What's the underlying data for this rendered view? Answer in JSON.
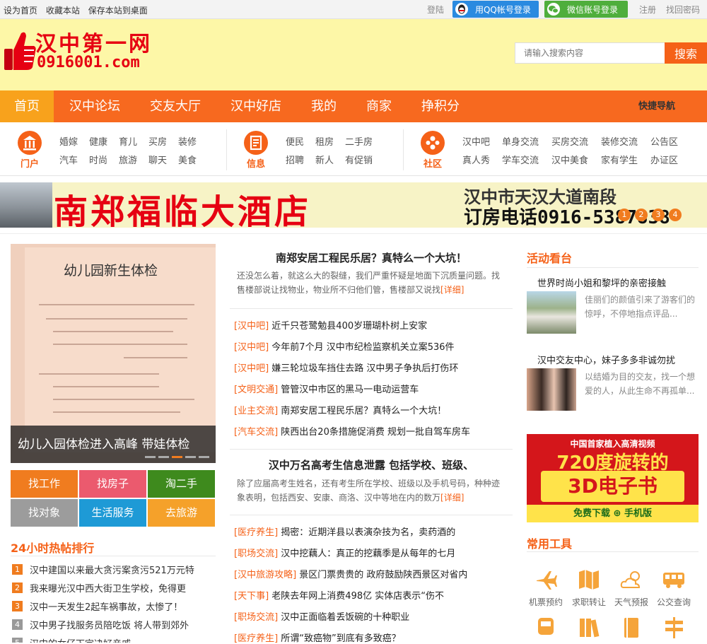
{
  "topbar": {
    "left": [
      "设为首页",
      "收藏本站",
      "保存本站到桌面"
    ],
    "login": "登陆",
    "qq_login": "用QQ帐号登录",
    "wx_login": "微信账号登录",
    "register": "注册",
    "find_password": "找回密码"
  },
  "header": {
    "logo_title": "汉中第一网",
    "logo_url": "0916001.com",
    "search_placeholder": "请输入搜索内容",
    "search_button": "搜索"
  },
  "nav": {
    "items": [
      "首页",
      "汉中论坛",
      "交友大厅",
      "汉中好店",
      "我的",
      "商家",
      "挣积分"
    ],
    "quick": "快捷导航"
  },
  "categories": [
    {
      "name": "门户",
      "icon": "building-icon",
      "links": [
        "婚嫁",
        "健康",
        "育儿",
        "买房",
        "装修",
        "汽车",
        "时尚",
        "旅游",
        "聊天",
        "美食"
      ]
    },
    {
      "name": "信息",
      "icon": "document-icon",
      "links": [
        "便民",
        "租房",
        "二手房",
        "招聘",
        "新人",
        "有促销"
      ]
    },
    {
      "name": "社区",
      "icon": "community-icon",
      "links": [
        "汉中吧",
        "单身交流",
        "买房交流",
        "装修交流",
        "公告区",
        "真人秀",
        "学车交流",
        "汉中美食",
        "家有学生",
        "办证区"
      ]
    }
  ],
  "banner": {
    "title": "南郑福临大酒店",
    "address": "汉中市天汉大道南段",
    "phone": "订房电话0916-5387838",
    "dots": [
      "1",
      "2",
      "3",
      "4"
    ]
  },
  "slider": {
    "paper_title": "幼儿园新生体检",
    "caption": "幼儿入园体检进入高峰 带娃体检"
  },
  "quicklinks": [
    "找工作",
    "找房子",
    "淘二手",
    "找对象",
    "生活服务",
    "去旅游"
  ],
  "hot": {
    "title": "24小时热帖排行",
    "items": [
      "汉中建国以来最大贪污案贪污521万元特",
      "我来曝光汉中西大街卫生学校，免得更",
      "汉中一天发生2起车祸事故，太惨了！",
      "汉中男子找服务员陪吃饭 将人带到郊外",
      "汉中的女仔下定决好亲戚"
    ]
  },
  "middle": {
    "headline1": "南郑安居工程民乐居？真特么一个大坑！",
    "summary1": "还没怎么着，就这么大的裂缝，我们严重怀疑是地面下沉质量问题。找售楼部说让找物业，物业所不归他们管，售楼部又说找",
    "more": "[详细]",
    "news1": [
      {
        "tag": "[汉中吧]",
        "text": "近千只苍鹭勉县400岁珊瑚朴树上安家"
      },
      {
        "tag": "[汉中吧]",
        "text": "今年前7个月 汉中市纪检监察机关立案536件"
      },
      {
        "tag": "[汉中吧]",
        "text": "嫌三轮垃圾车挡住去路 汉中男子争执后打伤环"
      },
      {
        "tag": "[文明交通]",
        "text": "管管汉中市区的黑马一电动运营车"
      },
      {
        "tag": "[业主交流]",
        "text": "南郑安居工程民乐居？真特么一个大坑！"
      },
      {
        "tag": "[汽车交流]",
        "text": "陕西出台20条措施促消费 规划一批自驾车房车"
      }
    ],
    "headline2": "汉中万名高考生信息泄露 包括学校、班级、",
    "summary2": "除了应届高考生姓名，还有考生所在学校、班级以及手机号码，种种迹象表明，包括西安、安康、商洛、汉中等地在内的数万",
    "news2": [
      {
        "tag": "[医疗养生]",
        "text": "揭密：近期洋县以表演杂技为名，卖药酒的"
      },
      {
        "tag": "[职场交流]",
        "text": "汉中挖藕人：真正的挖藕季是从每年的七月"
      },
      {
        "tag": "[汉中旅游攻略]",
        "text": "景区门票贵贵的 政府鼓励陕西景区对省内"
      },
      {
        "tag": "[天下事]",
        "text": "老陕去年网上消费498亿 实体店表示“伤不"
      },
      {
        "tag": "[职场交流]",
        "text": "汉中正面临着丢饭碗的十种职业"
      },
      {
        "tag": "[医疗养生]",
        "text": "所谓“致癌物”到底有多致癌？"
      }
    ]
  },
  "right": {
    "activity_title": "活动看台",
    "activities": [
      {
        "title": "世界时尚小姐和黎坪的亲密接触",
        "desc": "佳丽们的颜值引来了游客们的惊呼，不停地指点评品..."
      },
      {
        "title": "汉中交友中心，妹子多多非诚勿扰",
        "desc": "以结婚为目的交友，找一个想爱的人，从此生命不再孤单..."
      }
    ],
    "ad": {
      "line1": "中国首家植入高清视频",
      "line2": "720度旋转的",
      "line3": "3D电子书",
      "line4": "免费下载 ⊕ 手机版"
    },
    "tools_title": "常用工具",
    "tools": [
      {
        "label": "机票预约",
        "icon": "plane-icon"
      },
      {
        "label": "求职转让",
        "icon": "map-icon"
      },
      {
        "label": "天气预报",
        "icon": "weather-icon"
      },
      {
        "label": "公交查询",
        "icon": "bus-icon"
      },
      {
        "label": "",
        "icon": "train-icon"
      },
      {
        "label": "",
        "icon": "books-icon"
      },
      {
        "label": "",
        "icon": "book-icon"
      },
      {
        "label": "",
        "icon": "signpost-icon"
      }
    ]
  },
  "colors": {
    "accent": "#f56118",
    "nav": "#f7691f",
    "header_bg": "#fdf7a7"
  }
}
